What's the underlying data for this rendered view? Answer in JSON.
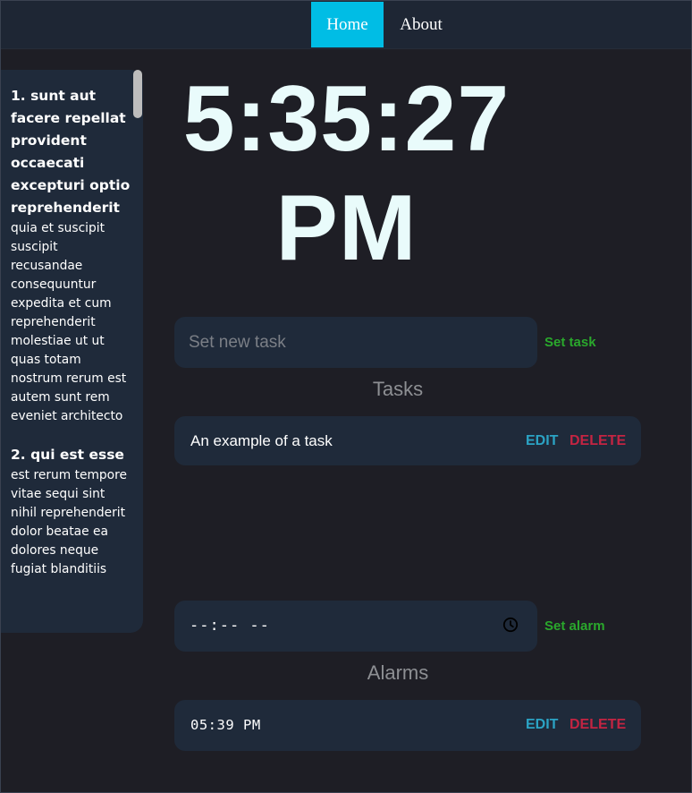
{
  "nav": {
    "home_label": "Home",
    "about_label": "About"
  },
  "colors": {
    "accent": "#00bde5",
    "set_action": "#2aa82c",
    "edit": "#2ba3c4",
    "delete": "#c42442",
    "panel": "#1f2a3a",
    "background": "#1e1e25"
  },
  "sidebar": {
    "posts": [
      {
        "title": "1. sunt aut facere repellat provident occaecati excepturi optio reprehenderit",
        "body": "quia et suscipit suscipit recusandae consequuntur expedita et cum reprehenderit molestiae ut ut quas totam nostrum rerum est autem sunt rem eveniet architecto"
      },
      {
        "title": "2. qui est esse",
        "body": "est rerum tempore vitae sequi sint nihil reprehenderit dolor beatae ea dolores neque fugiat blanditiis"
      }
    ]
  },
  "clock": {
    "time": "5:35:27 PM"
  },
  "tasks": {
    "input_placeholder": "Set new task",
    "input_value": "",
    "set_label": "Set task",
    "heading": "Tasks",
    "items": [
      {
        "text": "An example of a task",
        "edit_label": "EDIT",
        "delete_label": "DELETE"
      }
    ]
  },
  "alarms": {
    "input_display": "--:-- --",
    "input_icon": "clock-icon",
    "set_label": "Set alarm",
    "heading": "Alarms",
    "items": [
      {
        "time": "05:39 PM",
        "edit_label": "EDIT",
        "delete_label": "DELETE"
      }
    ]
  }
}
